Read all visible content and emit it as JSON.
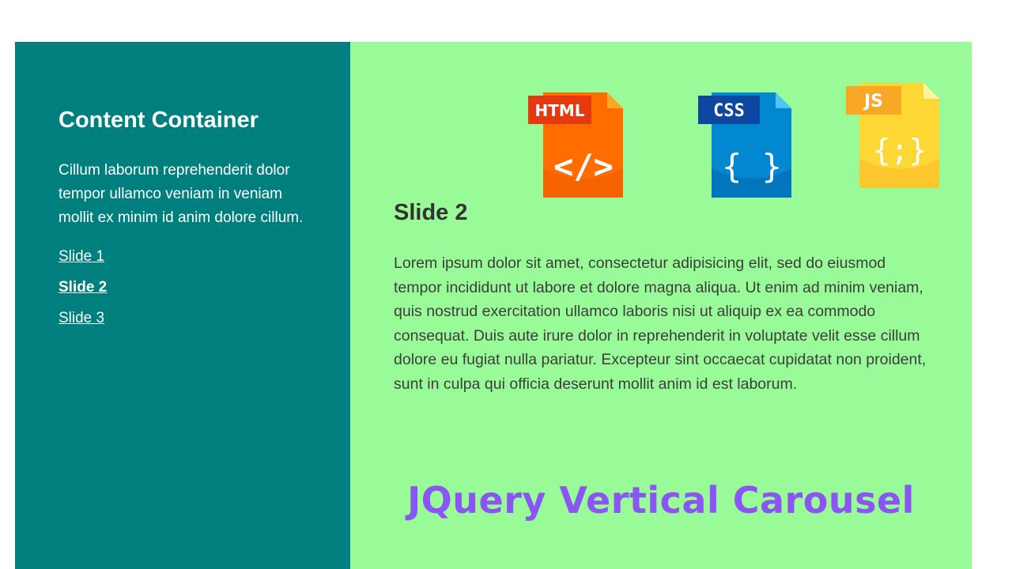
{
  "sidebar": {
    "heading": "Content Container",
    "description": "Cillum laborum reprehenderit dolor tempor ullamco veniam in veniam mollit ex minim id anim dolore cillum.",
    "nav": [
      {
        "label": "Slide 1",
        "active": false
      },
      {
        "label": "Slide 2",
        "active": true
      },
      {
        "label": "Slide 3",
        "active": false
      }
    ]
  },
  "slide": {
    "title": "Slide 2",
    "body": "Lorem ipsum dolor sit amet, consectetur adipisicing elit, sed do eiusmod tempor incididunt ut labore et dolore magna aliqua. Ut enim ad minim veniam, quis nostrud exercitation ullamco laboris nisi ut aliquip ex ea commodo consequat. Duis aute irure dolor in reprehenderit in voluptate velit esse cillum dolore eu fugiat nulla pariatur. Excepteur sint occaecat cupidatat non proident, sunt in culpa qui officia deserunt mollit anim id est laborum."
  },
  "icons": {
    "html": {
      "tag": "HTML",
      "glyph": "</>",
      "name": "html-file-icon"
    },
    "css": {
      "tag": "CSS",
      "glyph": "{ }",
      "name": "css-file-icon"
    },
    "js": {
      "tag": "JS",
      "glyph": "{;}",
      "name": "js-file-icon"
    }
  },
  "banner": "JQuery Vertical Carousel",
  "colors": {
    "sidebar_bg": "#007f7f",
    "main_bg": "#98fb98",
    "banner": "#8b55f5"
  }
}
